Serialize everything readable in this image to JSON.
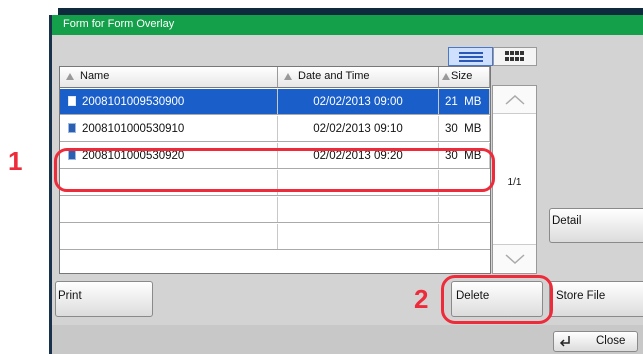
{
  "window": {
    "title": "Form for Form Overlay"
  },
  "view_toggle": {
    "list_icon": "list-view-icon",
    "thumb_icon": "thumbnail-view-icon"
  },
  "table": {
    "columns": [
      "Name",
      "Date and Time",
      "Size"
    ],
    "rows": [
      {
        "name": "2008101009530900",
        "date": "02/02/2013 09:00",
        "size": "21  MB",
        "selected": true
      },
      {
        "name": "2008101000530910",
        "date": "02/02/2013 09:10",
        "size": "30  MB",
        "selected": false
      },
      {
        "name": "2008101000530920",
        "date": "02/02/2013 09:20",
        "size": "30  MB",
        "selected": false
      }
    ]
  },
  "pager": {
    "page": "1/1"
  },
  "buttons": {
    "detail": "Detail",
    "print": "Print",
    "delete": "Delete",
    "store_file": "Store File",
    "close": "Close"
  },
  "callouts": {
    "one": "1",
    "two": "2"
  },
  "colors": {
    "title_green": "#14a04a",
    "selection_blue": "#1a5fc9",
    "callout_red": "#ee2b3a"
  }
}
